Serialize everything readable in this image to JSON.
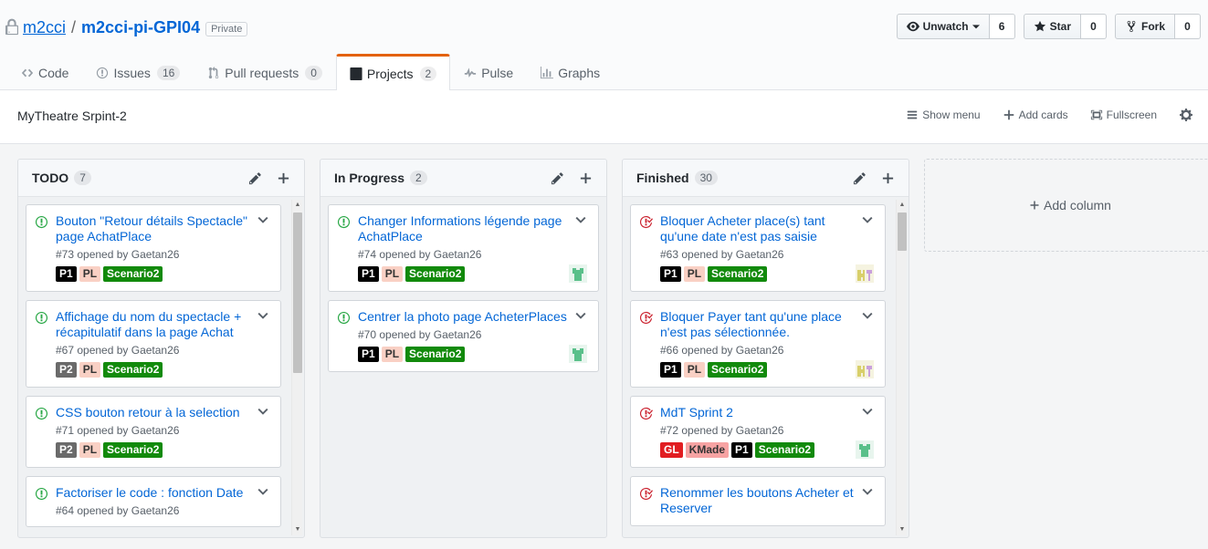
{
  "repo": {
    "owner": "m2cci",
    "separator": "/",
    "name": "m2cci-pi-GPI04",
    "visibility": "Private"
  },
  "actions": {
    "watch": {
      "label": "Unwatch",
      "count": "6"
    },
    "star": {
      "label": "Star",
      "count": "0"
    },
    "fork": {
      "label": "Fork",
      "count": "0"
    }
  },
  "tabs": [
    {
      "label": "Code",
      "icon": "code-icon"
    },
    {
      "label": "Issues",
      "count": "16",
      "icon": "issue-icon"
    },
    {
      "label": "Pull requests",
      "count": "0",
      "icon": "pull-request-icon"
    },
    {
      "label": "Projects",
      "count": "2",
      "icon": "project-icon",
      "selected": true
    },
    {
      "label": "Pulse",
      "icon": "pulse-icon"
    },
    {
      "label": "Graphs",
      "icon": "graph-icon"
    }
  ],
  "project": {
    "name": "MyTheatre Srpint-2",
    "tools": {
      "show_menu": "Show menu",
      "add_cards": "Add cards",
      "fullscreen": "Fullscreen"
    }
  },
  "colors": {
    "P1": "#000000",
    "P2": "#6a6a6a",
    "PL": "#f9d0c4",
    "Scenario2": "#128a0c",
    "GL": "#e11d21",
    "KMade": "#f7a3a3",
    "open": "#28a745",
    "closed": "#cb2431"
  },
  "columns": [
    {
      "title": "TODO",
      "count": "7",
      "cards": [
        {
          "state": "open",
          "title": "Bouton \"Retour détails Spectacle\" page AchatPlace",
          "meta": "#73 opened by Gaetan26",
          "labels": [
            "P1",
            "PL",
            "Scenario2"
          ],
          "avatar": ""
        },
        {
          "state": "open",
          "title": "Affichage du nom du spectacle + récapitulatif dans la page Achat",
          "meta": "#67 opened by Gaetan26",
          "labels": [
            "P2",
            "PL",
            "Scenario2"
          ],
          "avatar": ""
        },
        {
          "state": "open",
          "title": "CSS bouton retour à la selection",
          "meta": "#71 opened by Gaetan26",
          "labels": [
            "P2",
            "PL",
            "Scenario2"
          ],
          "avatar": ""
        },
        {
          "state": "open",
          "title": "Factoriser le code : fonction Date",
          "meta": "#64 opened by Gaetan26",
          "labels": [],
          "avatar": ""
        }
      ]
    },
    {
      "title": "In Progress",
      "count": "2",
      "cards": [
        {
          "state": "open",
          "title": "Changer Informations légende page AchatPlace",
          "meta": "#74 opened by Gaetan26",
          "labels": [
            "P1",
            "PL",
            "Scenario2"
          ],
          "avatar": "green"
        },
        {
          "state": "open",
          "title": "Centrer la photo page AcheterPlaces",
          "meta": "#70 opened by Gaetan26",
          "labels": [
            "P1",
            "PL",
            "Scenario2"
          ],
          "avatar": "green"
        }
      ]
    },
    {
      "title": "Finished",
      "count": "30",
      "cards": [
        {
          "state": "closed",
          "title": "Bloquer Acheter place(s) tant qu'une date n'est pas saisie",
          "meta": "#63 opened by Gaetan26",
          "labels": [
            "P1",
            "PL",
            "Scenario2"
          ],
          "avatar": "multi"
        },
        {
          "state": "closed",
          "title": "Bloquer Payer tant qu'une place n'est pas sélectionnée.",
          "meta": "#66 opened by Gaetan26",
          "labels": [
            "P1",
            "PL",
            "Scenario2"
          ],
          "avatar": "multi"
        },
        {
          "state": "closed",
          "title": "MdT Sprint 2",
          "meta": "#72 opened by Gaetan26",
          "labels": [
            "GL",
            "KMade",
            "P1",
            "Scenario2"
          ],
          "avatar": "green"
        },
        {
          "state": "closed",
          "title": "Renommer les boutons Acheter et Reserver",
          "meta": "",
          "labels": [],
          "avatar": ""
        }
      ]
    }
  ],
  "add_column": "Add column"
}
